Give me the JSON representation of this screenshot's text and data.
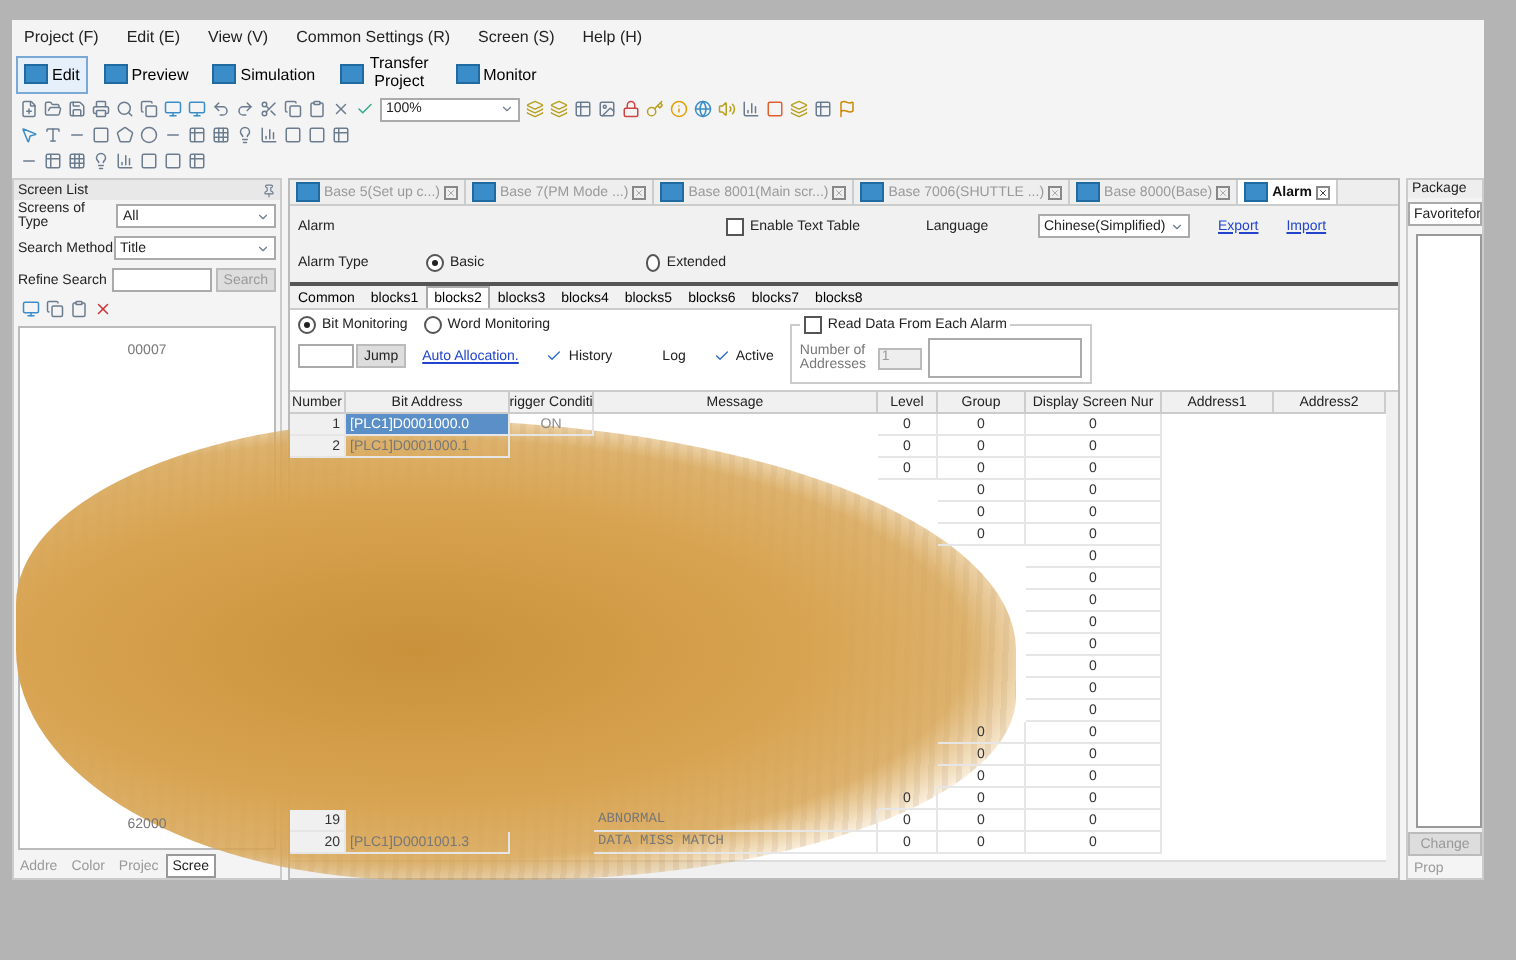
{
  "menu": [
    "Project (F)",
    "Edit (E)",
    "View (V)",
    "Common Settings (R)",
    "Screen (S)",
    "Help (H)"
  ],
  "modes": [
    {
      "label": "Edit",
      "selected": true
    },
    {
      "label": "Preview",
      "selected": false
    },
    {
      "label": "Simulation",
      "selected": false
    },
    {
      "label": "Transfer Project",
      "selected": false
    },
    {
      "label": "Monitor",
      "selected": false
    }
  ],
  "zoom": {
    "value": "100%"
  },
  "screen_list": {
    "title": "Screen List",
    "type_label": "Screens of Type",
    "type_value": "All",
    "method_label": "Search Method",
    "method_value": "Title",
    "refine_label": "Refine Search",
    "search_button": "Search",
    "items": [
      "00007",
      "62000"
    ],
    "tabs": [
      {
        "label": "Addre",
        "selected": false
      },
      {
        "label": "Color",
        "selected": false
      },
      {
        "label": "Projec",
        "selected": false
      },
      {
        "label": "Scree",
        "selected": true
      }
    ]
  },
  "doc_tabs": [
    {
      "label": "Base 5(Set up c...)",
      "selected": false
    },
    {
      "label": "Base 7(PM Mode ...)",
      "selected": false
    },
    {
      "label": "Base 8001(Main scr...)",
      "selected": false
    },
    {
      "label": "Base 7006(SHUTTLE ...)",
      "selected": false
    },
    {
      "label": "Base 8000(Base)",
      "selected": false
    },
    {
      "label": "Alarm",
      "selected": true
    }
  ],
  "alarm": {
    "title": "Alarm",
    "enable_text_table": {
      "label": "Enable Text Table",
      "checked": false
    },
    "language_label": "Language",
    "language_value": "Chinese(Simplified)",
    "export": "Export",
    "import": "Import",
    "type_label": "Alarm Type",
    "types": [
      {
        "label": "Basic",
        "selected": true
      },
      {
        "label": "Extended",
        "selected": false
      }
    ]
  },
  "blocks": [
    {
      "label": "Common",
      "selected": false
    },
    {
      "label": "blocks1",
      "selected": false
    },
    {
      "label": "blocks2",
      "selected": true
    },
    {
      "label": "blocks3",
      "selected": false
    },
    {
      "label": "blocks4",
      "selected": false
    },
    {
      "label": "blocks5",
      "selected": false
    },
    {
      "label": "blocks6",
      "selected": false
    },
    {
      "label": "blocks7",
      "selected": false
    },
    {
      "label": "blocks8",
      "selected": false
    }
  ],
  "monitoring": [
    {
      "label": "Bit Monitoring",
      "selected": true
    },
    {
      "label": "Word Monitoring",
      "selected": false
    }
  ],
  "jump_button": "Jump",
  "auto_allocation": "Auto Allocation.",
  "options": [
    {
      "label": "History",
      "checked": true
    },
    {
      "label": "Log",
      "checked": false
    },
    {
      "label": "Active",
      "checked": true
    }
  ],
  "read_data": {
    "label": "Read Data From Each Alarm",
    "checked": false,
    "addresses_label": "Number of Addresses",
    "addresses_value": "1"
  },
  "table": {
    "columns": [
      "Number",
      "Bit Address",
      "rigger Conditi",
      "Message",
      "Level",
      "Group",
      "Display Screen Nur",
      "Address1",
      "Address2"
    ],
    "rows": [
      {
        "number": "1",
        "bit_address": "[PLC1]D0001000.0",
        "trigger": "ON",
        "message": "",
        "level": "0",
        "group": "0",
        "display": "0",
        "selected": true
      },
      {
        "number": "2",
        "bit_address": "[PLC1]D0001000.1",
        "trigger": "",
        "message": "",
        "level": "0",
        "group": "0",
        "display": "0",
        "selected": false
      },
      {
        "number": "",
        "bit_address": "",
        "trigger": "",
        "message": "",
        "level": "0",
        "group": "0",
        "display": "0",
        "selected": false
      },
      {
        "number": "",
        "bit_address": "",
        "trigger": "",
        "message": "",
        "level": "",
        "group": "0",
        "display": "0",
        "selected": false
      },
      {
        "number": "",
        "bit_address": "",
        "trigger": "",
        "message": "",
        "level": "",
        "group": "0",
        "display": "0",
        "selected": false
      },
      {
        "number": "",
        "bit_address": "",
        "trigger": "",
        "message": "",
        "level": "",
        "group": "0",
        "display": "0",
        "selected": false
      },
      {
        "number": "",
        "bit_address": "",
        "trigger": "",
        "message": "",
        "level": "",
        "group": "",
        "display": "0",
        "selected": false
      },
      {
        "number": "",
        "bit_address": "",
        "trigger": "",
        "message": "",
        "level": "",
        "group": "",
        "display": "0",
        "selected": false
      },
      {
        "number": "",
        "bit_address": "",
        "trigger": "",
        "message": "",
        "level": "",
        "group": "",
        "display": "0",
        "selected": false
      },
      {
        "number": "",
        "bit_address": "",
        "trigger": "",
        "message": "",
        "level": "",
        "group": "",
        "display": "0",
        "selected": false
      },
      {
        "number": "",
        "bit_address": "",
        "trigger": "",
        "message": "",
        "level": "",
        "group": "",
        "display": "0",
        "selected": false
      },
      {
        "number": "",
        "bit_address": "",
        "trigger": "",
        "message": "",
        "level": "",
        "group": "",
        "display": "0",
        "selected": false
      },
      {
        "number": "",
        "bit_address": "",
        "trigger": "",
        "message": "",
        "level": "",
        "group": "",
        "display": "0",
        "selected": false
      },
      {
        "number": "",
        "bit_address": "",
        "trigger": "",
        "message": "",
        "level": "",
        "group": "",
        "display": "0",
        "selected": false
      },
      {
        "number": "",
        "bit_address": "",
        "trigger": "",
        "message": "",
        "level": "",
        "group": "0",
        "display": "0",
        "selected": false
      },
      {
        "number": "",
        "bit_address": "",
        "trigger": "",
        "message": "",
        "level": "",
        "group": "0",
        "display": "0",
        "selected": false
      },
      {
        "number": "",
        "bit_address": "",
        "trigger": "",
        "message": "",
        "level": "",
        "group": "0",
        "display": "0",
        "selected": false
      },
      {
        "number": "",
        "bit_address": "",
        "trigger": "",
        "message": "",
        "level": "0",
        "group": "0",
        "display": "0",
        "selected": false
      },
      {
        "number": "19",
        "bit_address": "",
        "trigger": "",
        "message": "ABNORMAL",
        "level": "0",
        "group": "0",
        "display": "0",
        "selected": false
      },
      {
        "number": "20",
        "bit_address": "[PLC1]D0001001.3",
        "trigger": "",
        "message": "DATA MISS MATCH",
        "level": "0",
        "group": "0",
        "display": "0",
        "selected": false
      }
    ]
  },
  "package": {
    "title": "Package",
    "dropdown": "Favoritefor",
    "button": "Change",
    "tab": "Prop"
  }
}
